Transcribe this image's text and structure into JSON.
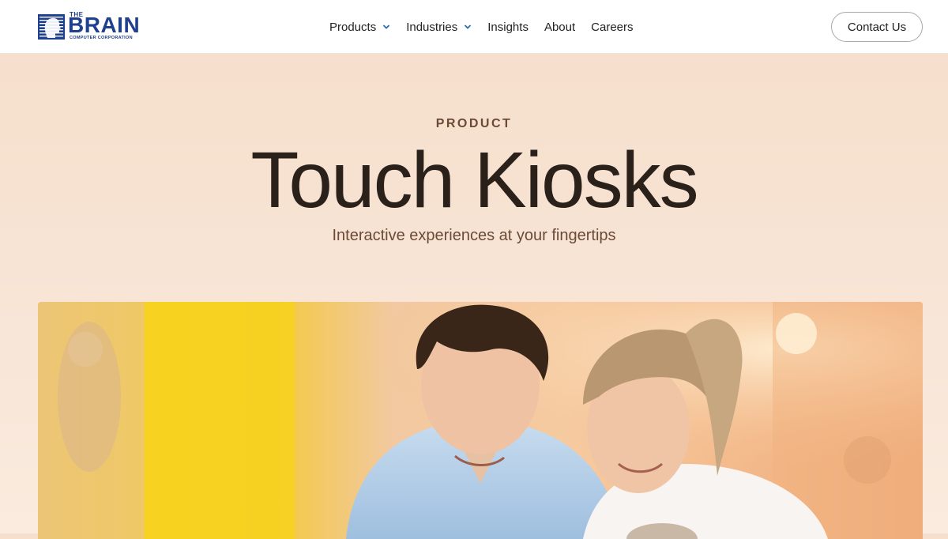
{
  "brand": {
    "logo_the": "THE",
    "logo_name": "BRAIN",
    "logo_sub": "COMPUTER CORPORATION",
    "logo_icon": "brain-head-icon",
    "color": "#1f3f8f"
  },
  "nav": {
    "items": [
      {
        "label": "Products",
        "has_dropdown": true
      },
      {
        "label": "Industries",
        "has_dropdown": true
      },
      {
        "label": "Insights",
        "has_dropdown": false
      },
      {
        "label": "About",
        "has_dropdown": false
      },
      {
        "label": "Careers",
        "has_dropdown": false
      }
    ],
    "chevron_color": "#2d6bb0"
  },
  "contact_button": {
    "label": "Contact Us"
  },
  "hero": {
    "eyebrow": "PRODUCT",
    "title": "Touch Kiosks",
    "subtitle": "Interactive experiences at your fingertips",
    "background": "#f6dfcc"
  },
  "hero_image": {
    "description_icon": "couple-using-kiosk-photo"
  }
}
